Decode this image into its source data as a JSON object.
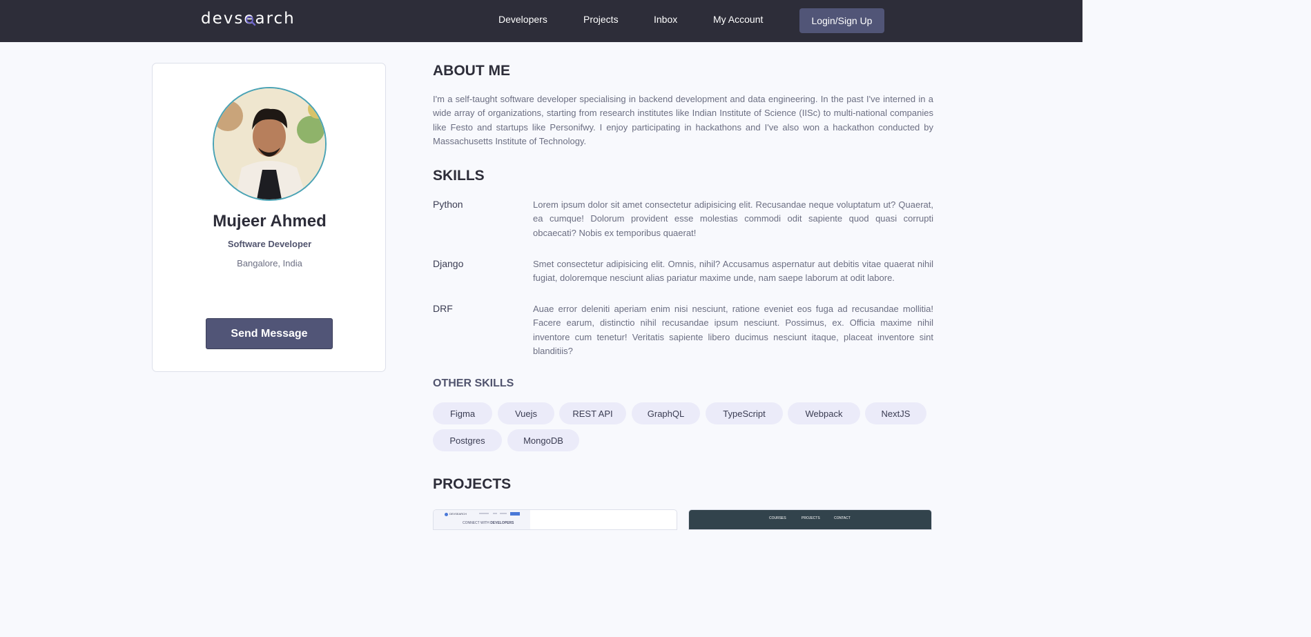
{
  "header": {
    "logo_text": "devsearch",
    "nav": [
      "Developers",
      "Projects",
      "Inbox",
      "My Account"
    ],
    "login_label": "Login/Sign Up"
  },
  "profile": {
    "name": "Mujeer Ahmed",
    "title": "Software Developer",
    "location": "Bangalore, India",
    "send_label": "Send Message"
  },
  "about": {
    "heading": "ABOUT ME",
    "text": "I'm a self-taught software developer specialising in backend development and data engineering. In the past I've interned in a wide array of organizations, starting from research institutes like Indian Institute of Science (IISc) to multi-national companies like Festo and startups like Personifwy. I enjoy participating in hackathons and I've also won a hackathon conducted by Massachusetts Institute of Technology."
  },
  "skills": {
    "heading": "SKILLS",
    "items": [
      {
        "name": "Python",
        "desc": "Lorem ipsum dolor sit amet consectetur adipisicing elit. Recusandae neque voluptatum ut? Quaerat, ea cumque! Dolorum provident esse molestias commodi odit sapiente quod quasi corrupti obcaecati? Nobis ex temporibus quaerat!"
      },
      {
        "name": "Django",
        "desc": "Smet consectetur adipisicing elit. Omnis, nihil? Accusamus aspernatur aut debitis vitae quaerat nihil fugiat, doloremque nesciunt alias pariatur maxime unde, nam saepe laborum at odit labore."
      },
      {
        "name": "DRF",
        "desc": "Auae error deleniti aperiam enim nisi nesciunt, ratione eveniet eos fuga ad recusandae mollitia! Facere earum, distinctio nihil recusandae ipsum nesciunt. Possimus, ex. Officia maxime nihil inventore cum tenetur! Veritatis sapiente libero ducimus nesciunt itaque, placeat inventore sint blanditiis?"
      }
    ]
  },
  "other_skills": {
    "heading": "OTHER SKILLS",
    "tags": [
      "Figma",
      "Vuejs",
      "REST API",
      "GraphQL",
      "TypeScript",
      "Webpack",
      "NextJS",
      "Postgres",
      "MongoDB"
    ]
  },
  "projects": {
    "heading": "PROJECTS",
    "thumb1": {
      "brand": "DEVSEARCH",
      "headline_prefix": "CONNECT WITH",
      "headline_strong": "DEVELOPERS"
    },
    "thumb2": {
      "nav": [
        "COURSES",
        "PROJECTS",
        "CONTACT"
      ]
    }
  },
  "colors": {
    "header_bg": "#2d2d39",
    "accent": "#515577",
    "tag_bg": "#ebebf9",
    "page_bg": "#f8f9fd"
  }
}
